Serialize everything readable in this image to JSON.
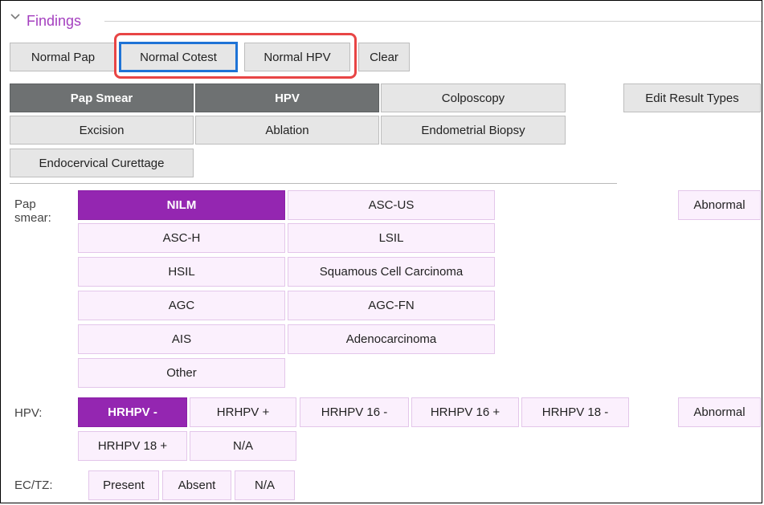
{
  "findings": {
    "title": "Findings",
    "quick_buttons": [
      "Normal Pap",
      "Normal Cotest",
      "Normal HPV",
      "Clear"
    ]
  },
  "result_types": {
    "tabs": [
      "Pap Smear",
      "HPV",
      "Colposcopy",
      "Excision",
      "Ablation",
      "Endometrial Biopsy",
      "Endocervical Curettage"
    ],
    "active": [
      "Pap Smear",
      "HPV"
    ],
    "edit_label": "Edit Result Types"
  },
  "pap_smear": {
    "label_line1": "Pap",
    "label_line2": "smear:",
    "options": [
      "NILM",
      "ASC-US",
      "ASC-H",
      "LSIL",
      "HSIL",
      "Squamous Cell Carcinoma",
      "AGC",
      "AGC-FN",
      "AIS",
      "Adenocarcinoma",
      "Other"
    ],
    "selected": "NILM",
    "abnormal_label": "Abnormal"
  },
  "hpv": {
    "label": "HPV:",
    "options": [
      "HRHPV -",
      "HRHPV +",
      "HRHPV 16 -",
      "HRHPV 16 +",
      "HRHPV 18 -",
      "HRHPV 18 +",
      "N/A"
    ],
    "selected": "HRHPV -",
    "abnormal_label": "Abnormal"
  },
  "ectz": {
    "label": "EC/TZ:",
    "options": [
      "Present",
      "Absent",
      "N/A"
    ]
  },
  "colors": {
    "accent": "#a43fbf",
    "selected_bg": "#9426b1",
    "option_bg": "#fbf0fd",
    "active_tab_bg": "#6e7172",
    "highlight_red": "#e84545",
    "highlight_blue": "#1e73d6"
  },
  "icons": {
    "collapse": "chevron-down-icon"
  }
}
